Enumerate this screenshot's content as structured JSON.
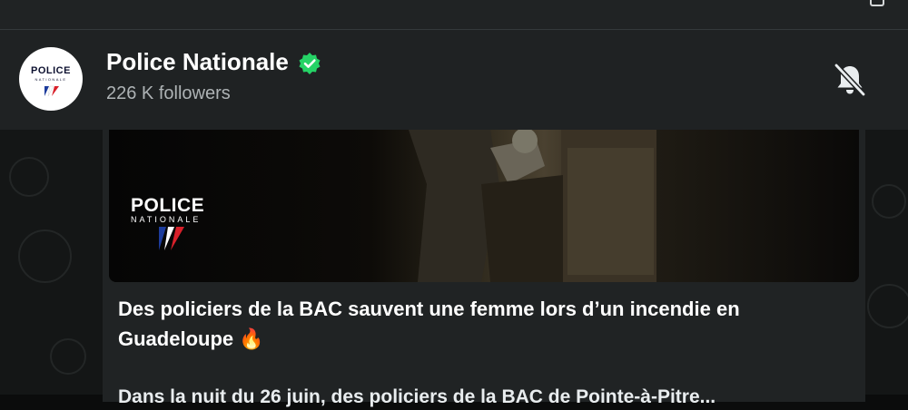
{
  "channel": {
    "name": "Police Nationale",
    "followers": "226 K followers",
    "avatar_text": "POLICE",
    "avatar_subtext": "NATIONALE",
    "verified_color": "#25d366"
  },
  "post": {
    "media_logo_text": "POLICE",
    "media_logo_subtext": "NATIONALE",
    "headline": "Des policiers de la BAC sauvent une femme lors d’un incendie en Guadeloupe 🔥",
    "body_start": "Dans la nuit du 26 juin, des policiers de la BAC de Pointe-à-Pitre..."
  },
  "icons": {
    "verified": "verified-check-icon",
    "mute": "bell-off-icon"
  }
}
